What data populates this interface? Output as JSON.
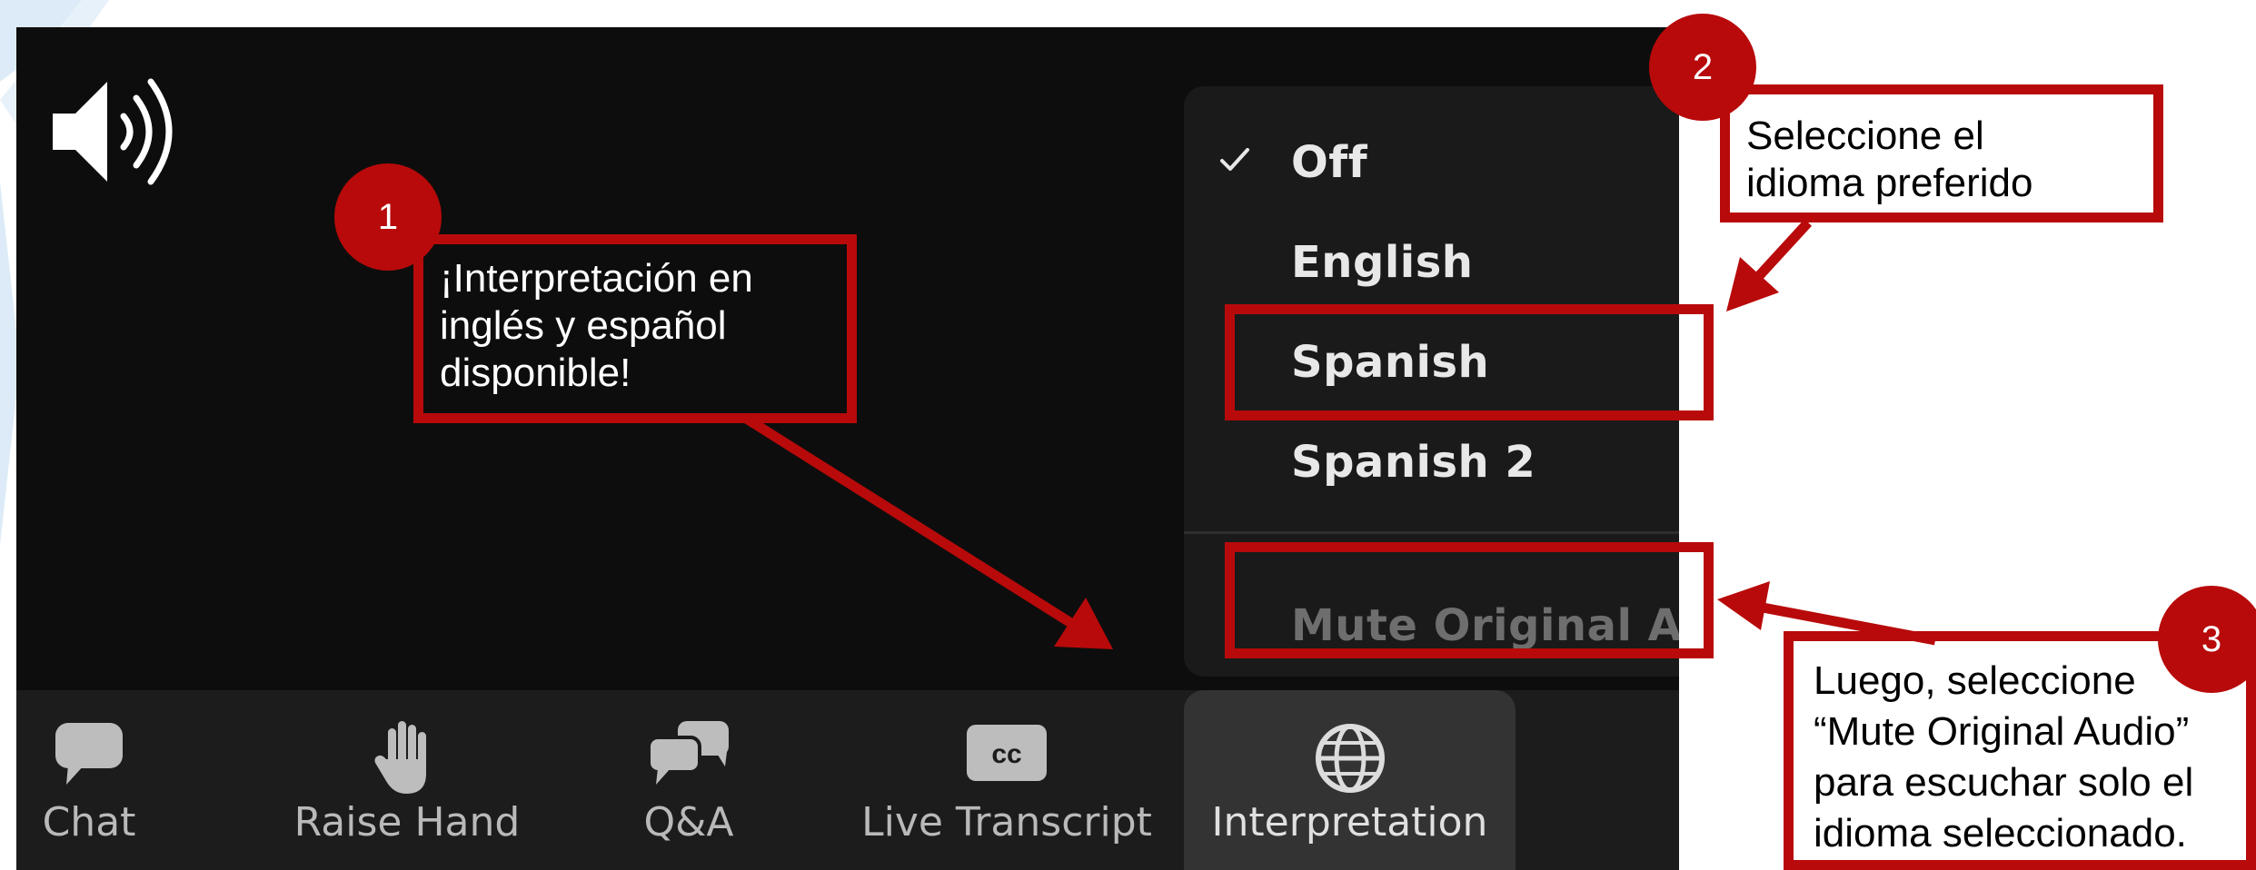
{
  "colors": {
    "accent_red": "#b80a0a",
    "zoom_background": "#0d0d0d",
    "toolbar_background": "#1c1c1c",
    "popup_background": "#1a1a1a"
  },
  "speaker": {
    "icon": "speaker-volume-icon"
  },
  "interpretation_menu": {
    "items": [
      {
        "label": "Off",
        "checked": true
      },
      {
        "label": "English",
        "checked": false
      },
      {
        "label": "Spanish",
        "checked": false
      },
      {
        "label": "Spanish 2",
        "checked": false
      }
    ],
    "mute_label": "Mute Original Audi"
  },
  "toolbar": {
    "buttons": [
      {
        "label": "Chat",
        "icon": "chat-bubble-icon"
      },
      {
        "label": "Raise Hand",
        "icon": "hand-icon"
      },
      {
        "label": "Q&A",
        "icon": "qa-bubbles-icon"
      },
      {
        "label": "Live Transcript",
        "icon": "cc-icon",
        "icon_text": "cc"
      },
      {
        "label": "Interpretation",
        "icon": "globe-icon",
        "active": true
      }
    ]
  },
  "callouts": {
    "c1": {
      "badge": "1",
      "lines": [
        "¡Interpretación en",
        "inglés y español",
        "disponible!"
      ]
    },
    "c2": {
      "badge": "2",
      "lines": [
        "Seleccione el",
        "idioma preferido"
      ]
    },
    "c3": {
      "badge": "3",
      "lines": [
        "Luego, seleccione",
        "“Mute Original Audio”",
        "para escuchar solo el",
        "idioma seleccionado."
      ]
    }
  }
}
